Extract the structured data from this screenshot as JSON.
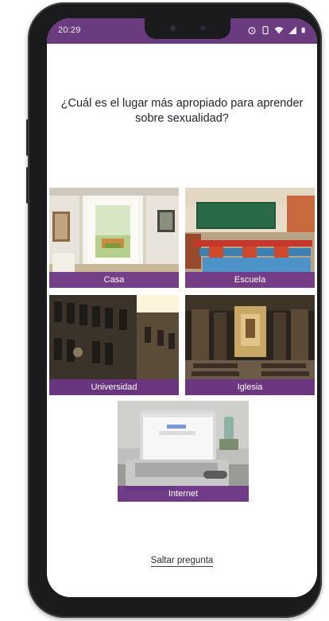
{
  "status_bar": {
    "time": "20:29",
    "icons": [
      "alarm-icon",
      "vibrate-icon",
      "wifi-icon",
      "signal-icon",
      "battery-icon"
    ],
    "background": "#6a3b7f"
  },
  "question": "¿Cuál es el lugar más apropiado para aprender sobre sexualidad?",
  "options": [
    {
      "label": "Casa",
      "image": "living-room-photo"
    },
    {
      "label": "Escuela",
      "image": "classroom-photo"
    },
    {
      "label": "Universidad",
      "image": "university-building-photo"
    },
    {
      "label": "Iglesia",
      "image": "church-interior-photo"
    },
    {
      "label": "Internet",
      "image": "laptop-photo"
    }
  ],
  "skip_label": "Saltar pregunta",
  "colors": {
    "accent": "#6e3485",
    "text": "#1d2430"
  }
}
